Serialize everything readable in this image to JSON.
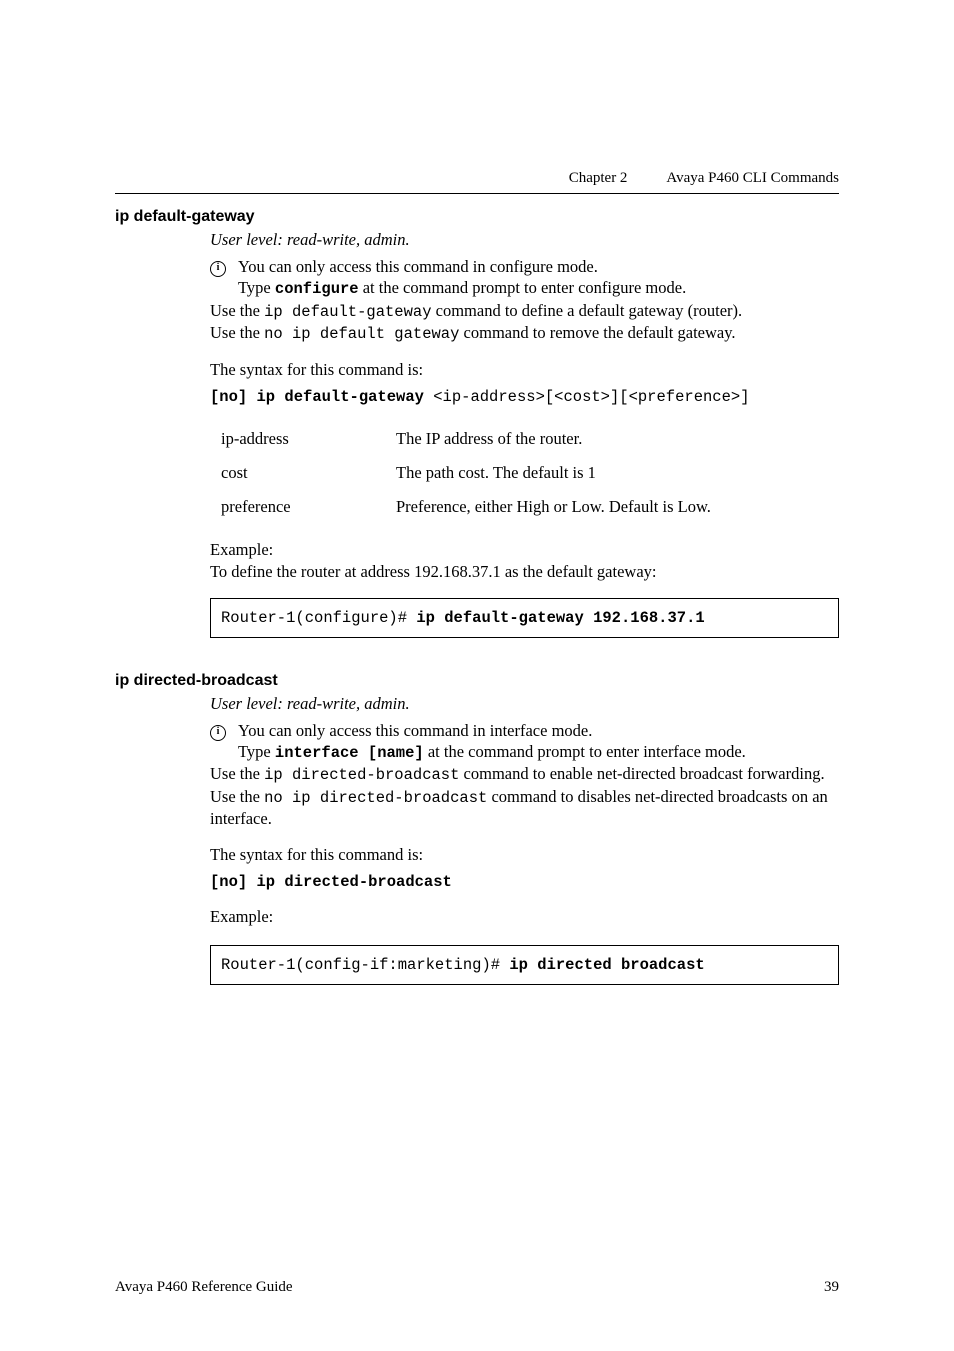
{
  "header": {
    "chapter_label": "Chapter 2",
    "chapter_title": "Avaya P460 CLI Commands"
  },
  "sections": {
    "default_gateway": {
      "heading": "ip default-gateway",
      "user_level": "User level: read-write, admin.",
      "info_line": "You can only access this command in configure mode.",
      "type_line_prefix": "Type ",
      "type_cmd": "configure",
      "type_line_suffix": " at the command prompt to enter configure mode.",
      "use_1_a": "Use the ",
      "use_1_b": "ip default-gateway",
      "use_1_c": " command to define a default gateway (router).",
      "use_2_a": "Use the ",
      "use_2_b": "no ip default gateway",
      "use_2_c": " command to remove the default gateway.",
      "syntax_label": "The syntax for this command is:",
      "syntax_cmd_bold": "[no] ip default-gateway ",
      "syntax_cmd_rest": "<ip-address>[<cost>][<preference>]",
      "params": {
        "p1_name": "ip-address",
        "p1_desc": "The IP address of the router.",
        "p2_name": "cost",
        "p2_desc": "The path cost. The default is 1",
        "p3_name": "preference",
        "p3_desc": "Preference, either High or Low. Default is Low."
      },
      "example_label": "Example:",
      "example_desc": "To define the router at address 192.168.37.1 as the default gateway:",
      "code_prompt": "Router-1(configure)# ",
      "code_cmd": "ip default-gateway 192.168.37.1"
    },
    "directed_broadcast": {
      "heading": "ip directed-broadcast",
      "user_level": "User level: read-write, admin.",
      "info_line": "You can only access this command in interface mode.",
      "type_line_prefix": "Type ",
      "type_cmd": "interface [name]",
      "type_line_suffix": " at the command prompt to enter interface mode.",
      "use_1_a": "Use the ",
      "use_1_b": "ip directed-broadcast",
      "use_1_c": " command to enable net-directed broadcast forwarding.",
      "use_2_a": "Use the ",
      "use_2_b": "no ip directed-broadcast",
      "use_2_c": " command to disables net-directed broadcasts on an interface.",
      "syntax_label": "The syntax for this command is:",
      "syntax_cmd_bold": "[no] ip directed-broadcast",
      "example_label": "Example:",
      "code_prompt": "Router-1(config-if:marketing)# ",
      "code_cmd": "ip directed broadcast"
    }
  },
  "footer": {
    "left": "Avaya P460 Reference Guide",
    "right": "39"
  }
}
